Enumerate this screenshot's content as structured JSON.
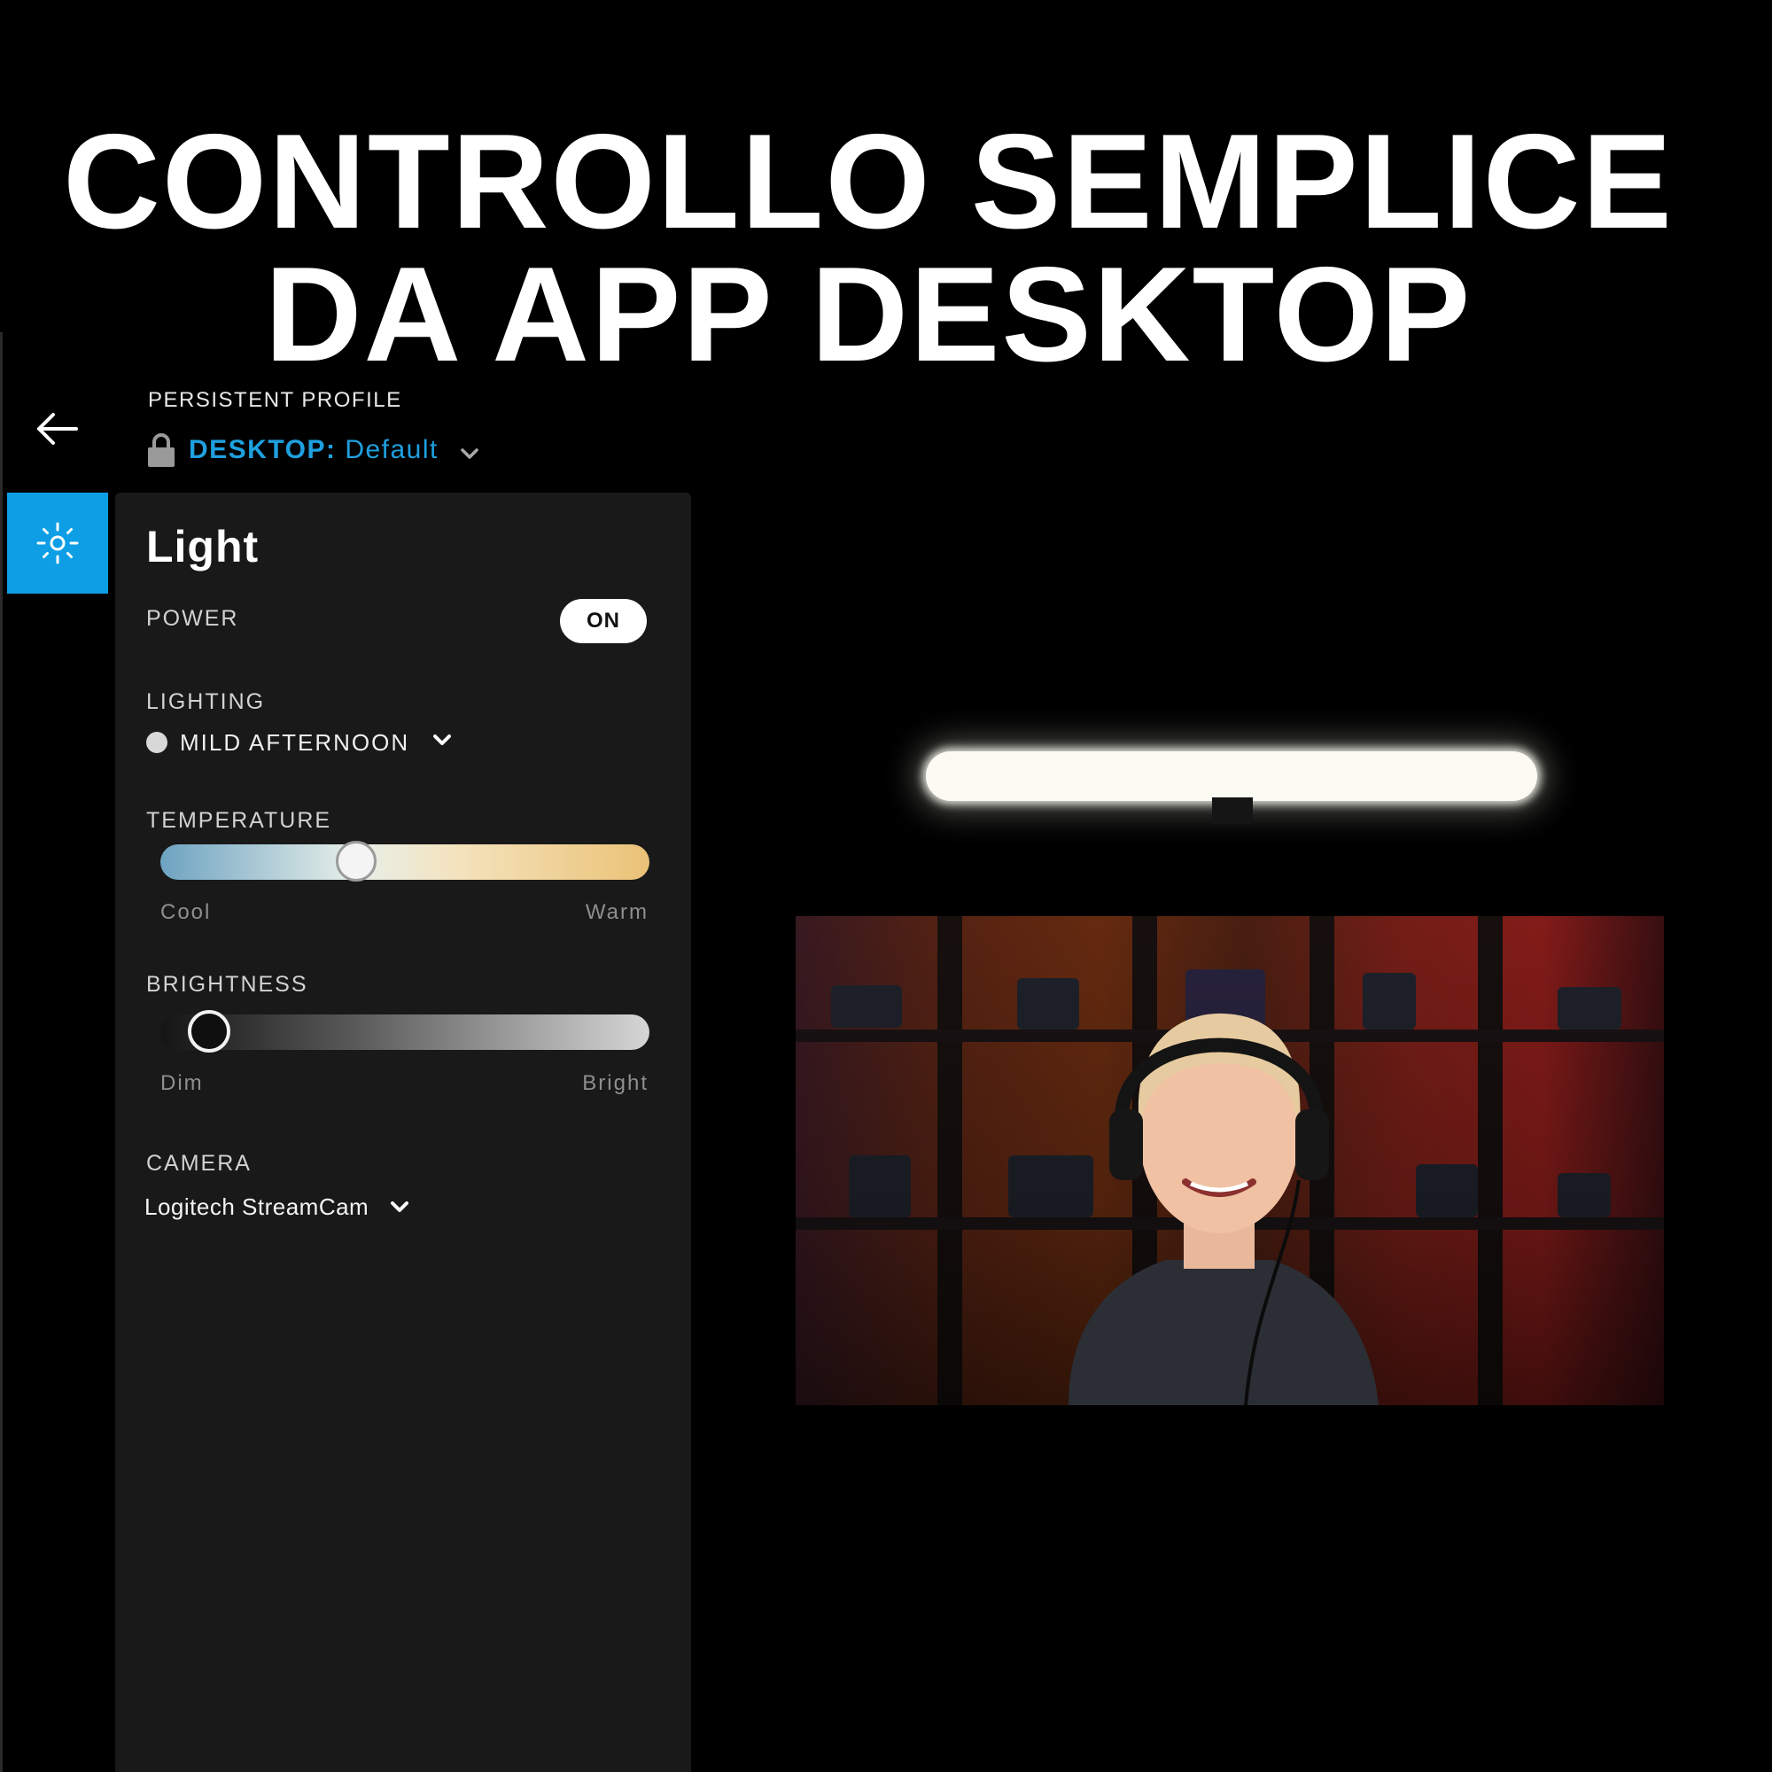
{
  "headline": {
    "line1": "CONTROLLO SEMPLICE",
    "line2": "DA APP DESKTOP"
  },
  "header": {
    "profile_label": "PERSISTENT PROFILE",
    "profile_prefix": "DESKTOP:",
    "profile_value": "Default"
  },
  "light_panel": {
    "title": "Light",
    "power": {
      "label": "POWER",
      "state": "ON"
    },
    "lighting": {
      "label": "LIGHTING",
      "value": "MILD AFTERNOON"
    },
    "temperature": {
      "label": "TEMPERATURE",
      "min_label": "Cool",
      "max_label": "Warm",
      "level": 0.4
    },
    "brightness": {
      "label": "BRIGHTNESS",
      "min_label": "Dim",
      "max_label": "Bright",
      "level": 0.1
    },
    "camera": {
      "label": "CAMERA",
      "value": "Logitech StreamCam"
    }
  },
  "colors": {
    "accent": "#1fa0df",
    "tab_active": "#0d9ee6",
    "panel_bg": "#191919",
    "background": "#000000"
  },
  "icons": {
    "back": "arrow-left-icon",
    "lock": "lock-icon",
    "profile_dropdown": "chevron-down-icon",
    "light_tab": "sun-icon",
    "lighting_swatch": "color-dot-icon",
    "lighting_dropdown": "chevron-down-icon",
    "camera_dropdown": "chevron-down-icon"
  }
}
